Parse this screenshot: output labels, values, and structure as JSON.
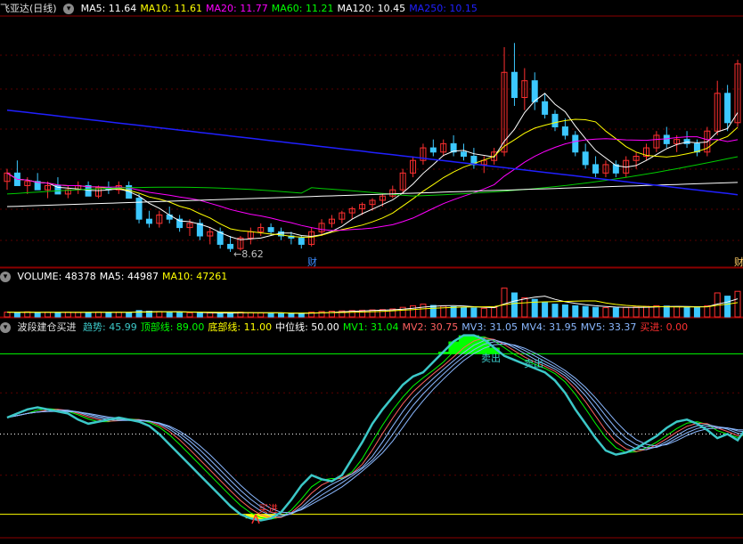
{
  "header": {
    "stock_title": "飞亚达(日线)",
    "ma": [
      {
        "label": "MA5: 11.64",
        "color": "#ffffff"
      },
      {
        "label": "MA10: 11.61",
        "color": "#ffff00"
      },
      {
        "label": "MA20: 11.77",
        "color": "#ff00ff"
      },
      {
        "label": "MA60: 11.21",
        "color": "#00ff00"
      },
      {
        "label": "MA120: 10.45",
        "color": "#ffffff"
      },
      {
        "label": "MA250: 10.15",
        "color": "#2020ff"
      }
    ]
  },
  "volume_header": [
    {
      "label": "VOLUME: 48378",
      "color": "#ffffff"
    },
    {
      "label": "MA5: 44987",
      "color": "#ffffff"
    },
    {
      "label": "MA10: 47261",
      "color": "#ffff00"
    }
  ],
  "indicator_header": {
    "name": "波段建仓买进",
    "items": [
      {
        "label": "趋势: 45.99",
        "color": "#3cc8c8"
      },
      {
        "label": "顶部线: 89.00",
        "color": "#00ff00"
      },
      {
        "label": "底部线: 11.00",
        "color": "#ffff00"
      },
      {
        "label": "中位线: 50.00",
        "color": "#ffffff"
      },
      {
        "label": "MV1: 31.04",
        "color": "#00ff00"
      },
      {
        "label": "MV2: 30.75",
        "color": "#ff6060"
      },
      {
        "label": "MV3: 31.05",
        "color": "#8ab8ff"
      },
      {
        "label": "MV4: 31.95",
        "color": "#8ab8ff"
      },
      {
        "label": "MV5: 33.37",
        "color": "#8ab8ff"
      },
      {
        "label": "买进: 0.00",
        "color": "#ff3030"
      }
    ]
  },
  "annotations": {
    "low_price": "←8.62",
    "finance_mark_1": "财",
    "finance_mark_2": "财",
    "sell_1": "卖出",
    "sell_2": "卖出",
    "buy": "买进"
  },
  "chart_data": [
    {
      "type": "candlestick",
      "title": "飞亚达(日线)",
      "price_range": [
        8.3,
        14.2
      ],
      "annotated_low": 8.62,
      "ma_series": [
        {
          "name": "MA5",
          "color": "#ffffff",
          "last": 11.64
        },
        {
          "name": "MA10",
          "color": "#ffff00",
          "last": 11.61
        },
        {
          "name": "MA20",
          "color": "#ff00ff",
          "last": 11.77
        },
        {
          "name": "MA60",
          "color": "#00ff00",
          "last": 11.21
        },
        {
          "name": "MA120",
          "color": "#ffffff",
          "last": 10.45
        },
        {
          "name": "MA250",
          "color": "#2020ff",
          "last": 10.15
        }
      ],
      "candles_ohlc": [
        [
          10.3,
          10.6,
          10.1,
          10.5
        ],
        [
          10.5,
          10.8,
          10.4,
          10.2
        ],
        [
          10.2,
          10.4,
          10.0,
          10.3
        ],
        [
          10.3,
          10.5,
          10.2,
          10.1
        ],
        [
          10.1,
          10.3,
          9.9,
          10.2
        ],
        [
          10.2,
          10.4,
          10.0,
          10.0
        ],
        [
          10.0,
          10.2,
          9.9,
          10.1
        ],
        [
          10.1,
          10.3,
          10.0,
          10.2
        ],
        [
          10.2,
          10.3,
          10.0,
          9.95
        ],
        [
          9.95,
          10.2,
          9.9,
          10.15
        ],
        [
          10.15,
          10.3,
          10.0,
          10.1
        ],
        [
          10.1,
          10.3,
          10.0,
          10.2
        ],
        [
          10.2,
          10.3,
          10.0,
          9.9
        ],
        [
          9.9,
          10.0,
          9.3,
          9.4
        ],
        [
          9.4,
          9.6,
          9.2,
          9.3
        ],
        [
          9.3,
          9.6,
          9.2,
          9.5
        ],
        [
          9.5,
          9.7,
          9.3,
          9.4
        ],
        [
          9.4,
          9.5,
          9.1,
          9.2
        ],
        [
          9.2,
          9.4,
          9.0,
          9.3
        ],
        [
          9.3,
          9.4,
          8.9,
          9.0
        ],
        [
          9.0,
          9.2,
          8.8,
          9.1
        ],
        [
          9.1,
          9.2,
          8.7,
          8.8
        ],
        [
          8.8,
          9.0,
          8.62,
          8.7
        ],
        [
          8.7,
          9.0,
          8.65,
          8.95
        ],
        [
          8.95,
          9.2,
          8.8,
          9.1
        ],
        [
          9.1,
          9.3,
          9.0,
          9.2
        ],
        [
          9.2,
          9.3,
          9.0,
          9.1
        ],
        [
          9.1,
          9.2,
          8.9,
          9.0
        ],
        [
          9.0,
          9.1,
          8.8,
          8.95
        ],
        [
          8.95,
          9.0,
          8.7,
          8.8
        ],
        [
          8.8,
          9.2,
          8.75,
          9.1
        ],
        [
          9.1,
          9.4,
          9.0,
          9.3
        ],
        [
          9.3,
          9.5,
          9.2,
          9.4
        ],
        [
          9.4,
          9.6,
          9.3,
          9.55
        ],
        [
          9.55,
          9.7,
          9.4,
          9.65
        ],
        [
          9.65,
          9.8,
          9.5,
          9.75
        ],
        [
          9.75,
          9.9,
          9.6,
          9.85
        ],
        [
          9.85,
          10.0,
          9.7,
          9.95
        ],
        [
          9.95,
          10.2,
          9.9,
          10.1
        ],
        [
          10.1,
          10.6,
          10.0,
          10.5
        ],
        [
          10.5,
          10.9,
          10.4,
          10.8
        ],
        [
          10.8,
          11.2,
          10.7,
          11.1
        ],
        [
          11.1,
          11.3,
          10.9,
          11.0
        ],
        [
          11.0,
          11.3,
          10.9,
          11.2
        ],
        [
          11.2,
          11.4,
          10.9,
          11.0
        ],
        [
          11.0,
          11.2,
          10.8,
          10.9
        ],
        [
          10.9,
          11.1,
          10.6,
          10.7
        ],
        [
          10.7,
          10.9,
          10.5,
          10.8
        ],
        [
          10.8,
          11.1,
          10.7,
          11.0
        ],
        [
          11.0,
          13.5,
          10.9,
          12.9
        ],
        [
          12.9,
          13.6,
          12.1,
          12.3
        ],
        [
          12.3,
          13.0,
          12.0,
          12.7
        ],
        [
          12.7,
          12.9,
          12.0,
          12.2
        ],
        [
          12.2,
          12.4,
          11.8,
          11.9
        ],
        [
          11.9,
          12.0,
          11.5,
          11.6
        ],
        [
          11.6,
          11.8,
          11.3,
          11.4
        ],
        [
          11.4,
          11.5,
          10.9,
          11.0
        ],
        [
          11.0,
          11.2,
          10.6,
          10.7
        ],
        [
          10.7,
          10.9,
          10.4,
          10.5
        ],
        [
          10.5,
          10.8,
          10.4,
          10.7
        ],
        [
          10.7,
          10.8,
          10.4,
          10.5
        ],
        [
          10.5,
          10.9,
          10.4,
          10.8
        ],
        [
          10.8,
          11.0,
          10.6,
          10.9
        ],
        [
          10.9,
          11.2,
          10.8,
          11.1
        ],
        [
          11.1,
          11.5,
          11.0,
          11.4
        ],
        [
          11.4,
          11.6,
          11.1,
          11.2
        ],
        [
          11.2,
          11.4,
          11.0,
          11.3
        ],
        [
          11.3,
          11.5,
          11.1,
          11.2
        ],
        [
          11.2,
          11.3,
          10.9,
          11.0
        ],
        [
          11.0,
          11.6,
          10.9,
          11.5
        ],
        [
          11.5,
          12.7,
          11.4,
          12.4
        ],
        [
          12.4,
          12.6,
          11.5,
          11.7
        ],
        [
          11.7,
          13.2,
          11.6,
          13.1
        ]
      ]
    },
    {
      "type": "bar",
      "title": "VOLUME",
      "series": [
        {
          "name": "VOLUME",
          "last": 48378
        },
        {
          "name": "MA5",
          "last": 44987
        },
        {
          "name": "MA10",
          "last": 47261
        }
      ],
      "values": [
        30,
        28,
        32,
        26,
        30,
        28,
        30,
        29,
        27,
        31,
        29,
        30,
        28,
        40,
        36,
        34,
        30,
        28,
        26,
        24,
        26,
        22,
        25,
        30,
        28,
        26,
        24,
        22,
        20,
        22,
        30,
        34,
        36,
        38,
        40,
        42,
        44,
        46,
        50,
        60,
        70,
        80,
        72,
        68,
        64,
        60,
        56,
        54,
        58,
        180,
        150,
        120,
        110,
        90,
        80,
        75,
        70,
        65,
        60,
        58,
        56,
        60,
        62,
        66,
        70,
        68,
        64,
        60,
        58,
        70,
        150,
        130,
        160
      ]
    },
    {
      "type": "line",
      "title": "波段建仓买进",
      "ylim": [
        0,
        100
      ],
      "reference_lines": [
        {
          "name": "顶部线",
          "value": 89.0,
          "color": "#00ff00"
        },
        {
          "name": "底部线",
          "value": 11.0,
          "color": "#ffff00"
        },
        {
          "name": "中位线",
          "value": 50.0,
          "color": "#ffffff"
        }
      ],
      "series": [
        {
          "name": "趋势",
          "color": "#3cc8c8",
          "last": 45.99
        },
        {
          "name": "MV1",
          "color": "#00ff00",
          "last": 31.04
        },
        {
          "name": "MV2",
          "color": "#ff6060",
          "last": 30.75
        },
        {
          "name": "MV3",
          "color": "#8ab8ff",
          "last": 31.05
        },
        {
          "name": "MV4",
          "color": "#8ab8ff",
          "last": 31.95
        },
        {
          "name": "MV5",
          "color": "#8ab8ff",
          "last": 33.37
        },
        {
          "name": "买进",
          "color": "#ff3030",
          "last": 0.0
        }
      ],
      "trend_values": [
        58,
        60,
        62,
        63,
        62,
        61,
        60,
        57,
        55,
        56,
        57,
        58,
        57,
        56,
        54,
        50,
        45,
        40,
        35,
        30,
        25,
        20,
        15,
        11,
        9,
        8,
        9,
        12,
        18,
        25,
        30,
        28,
        27,
        30,
        38,
        46,
        55,
        62,
        68,
        74,
        78,
        80,
        85,
        90,
        95,
        98,
        98,
        96,
        92,
        88,
        86,
        84,
        82,
        80,
        76,
        70,
        62,
        55,
        48,
        42,
        40,
        41,
        43,
        46,
        49,
        53,
        56,
        57,
        55,
        52,
        48,
        50,
        47,
        54,
        62
      ]
    }
  ]
}
